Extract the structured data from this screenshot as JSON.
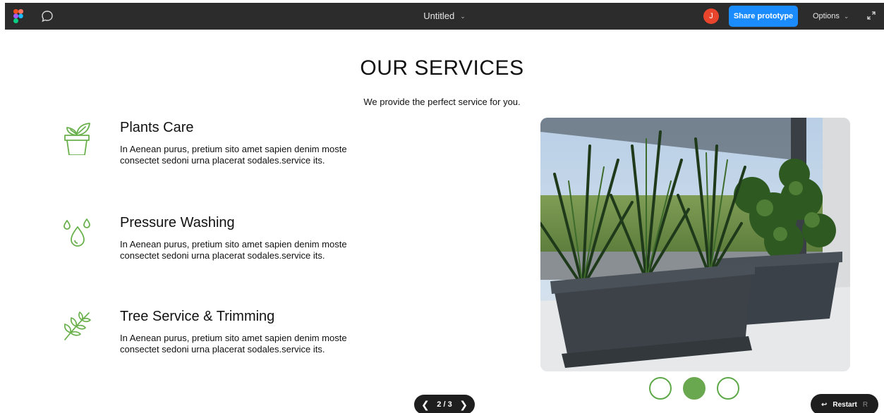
{
  "toolbar": {
    "file_title": "Untitled",
    "avatar_initial": "J",
    "share_label": "Share prototype",
    "options_label": "Options",
    "colors": {
      "bar": "#2c2c2c",
      "share": "#1a8cff",
      "avatar": "#e8452c"
    }
  },
  "page": {
    "title": "OUR SERVICES",
    "subtitle": "We provide the perfect service for you.",
    "accent": "#6aa84f"
  },
  "services": [
    {
      "icon": "plant-pot-icon",
      "name": "Plants Care",
      "description": "In Aenean purus, pretium sito amet sapien denim moste consectet sedoni urna placerat sodales.service its."
    },
    {
      "icon": "water-drops-icon",
      "name": "Pressure Washing",
      "description": "In Aenean purus, pretium sito amet sapien denim moste consectet sedoni urna placerat sodales.service its."
    },
    {
      "icon": "leaf-branch-icon",
      "name": "Tree Service & Trimming",
      "description": "In Aenean purus, pretium sito amet sapien denim moste consectet sedoni urna placerat sodales.service its."
    }
  ],
  "carousel": {
    "slides": 3,
    "active_index": 1
  },
  "footer": {
    "pager_text": "2 / 3",
    "restart_label": "Restart",
    "restart_key": "R"
  }
}
